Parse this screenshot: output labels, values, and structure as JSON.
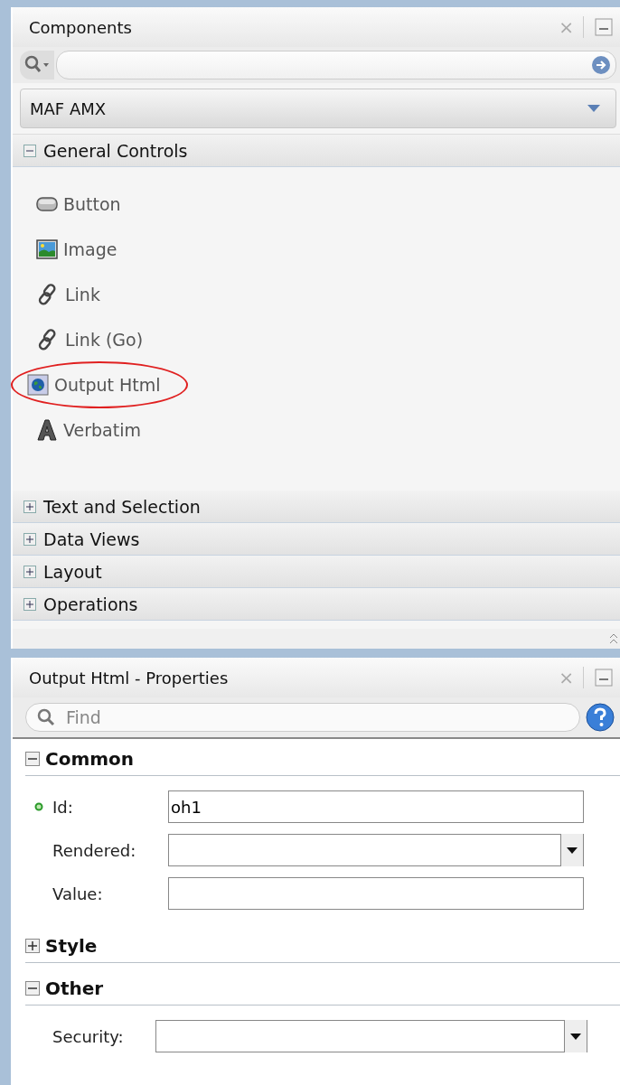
{
  "components_panel": {
    "title": "Components",
    "close_label": "×",
    "library": {
      "value": "MAF AMX"
    },
    "groups": [
      {
        "label": "General Controls",
        "expanded": true,
        "items": [
          {
            "label": "Button",
            "kind": "button",
            "highlighted": false
          },
          {
            "label": "Image",
            "kind": "image",
            "highlighted": false
          },
          {
            "label": "Link",
            "kind": "link",
            "highlighted": false
          },
          {
            "label": "Link (Go)",
            "kind": "link",
            "highlighted": false
          },
          {
            "label": "Output Html",
            "kind": "globe",
            "highlighted": true
          },
          {
            "label": "Verbatim",
            "kind": "verbatim",
            "highlighted": false
          }
        ]
      },
      {
        "label": "Text and Selection",
        "expanded": false
      },
      {
        "label": "Data Views",
        "expanded": false
      },
      {
        "label": "Layout",
        "expanded": false
      },
      {
        "label": "Operations",
        "expanded": false
      }
    ]
  },
  "properties_panel": {
    "title": "Output Html - Properties",
    "close_label": "×",
    "search": {
      "placeholder": "Find"
    },
    "sections": [
      {
        "label": "Common",
        "expanded": true,
        "properties": [
          {
            "label": "Id:",
            "kind": "text",
            "value": "oh1",
            "required": true
          },
          {
            "label": "Rendered:",
            "kind": "dropdown",
            "required": false
          },
          {
            "label": "Value:",
            "kind": "text",
            "required": false
          }
        ]
      },
      {
        "label": "Style",
        "expanded": false
      },
      {
        "label": "Other",
        "expanded": true,
        "properties": [
          {
            "label": "Security:",
            "kind": "dropdown",
            "required": false
          }
        ]
      }
    ]
  }
}
